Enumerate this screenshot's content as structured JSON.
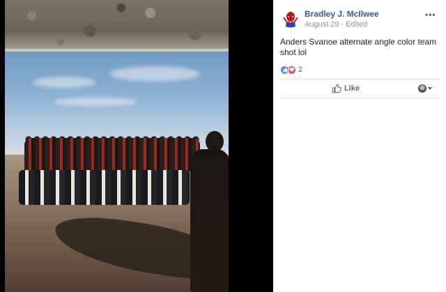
{
  "photo": {
    "alt_subject": "team-photo"
  },
  "post": {
    "author": "Bradley J. McIlwee",
    "date": "August 29",
    "separator": "·",
    "edited_label": "Edited",
    "more_label": "•••",
    "text": "Anders Svanoe alternate angle color team shot lol",
    "reaction_count": "2",
    "reactions": [
      "like-icon",
      "love-icon"
    ],
    "like_label": "Like"
  },
  "colors": {
    "author_link": "#365899",
    "meta_text": "#90949c",
    "like_reaction": "#4d87f6",
    "love_reaction": "#ec4b5d"
  }
}
